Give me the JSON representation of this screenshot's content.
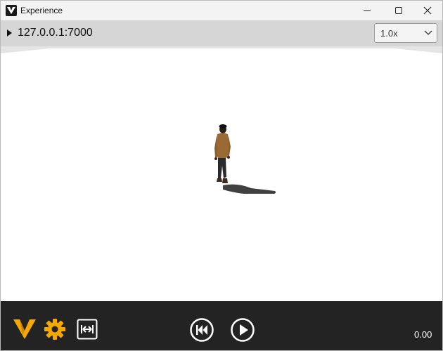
{
  "window": {
    "title": "Experience",
    "icons": {
      "app": "app-logo-icon",
      "minimize": "minimize-icon",
      "maximize": "maximize-icon",
      "close": "close-icon"
    }
  },
  "address_bar": {
    "address": "127.0.0.1:7000",
    "toggle_icon": "play-triangle-icon",
    "speed": {
      "selected": "1.0x",
      "icon": "chevron-down-icon"
    }
  },
  "scene": {
    "background_color": "#ffffff",
    "objects": [
      "character",
      "character-shadow"
    ]
  },
  "controls": {
    "icons": [
      "brand-v-icon",
      "settings-gear-icon",
      "fit-width-icon",
      "rewind-icon",
      "play-icon"
    ],
    "accent_color": "#f5a800",
    "time": "0.00"
  }
}
